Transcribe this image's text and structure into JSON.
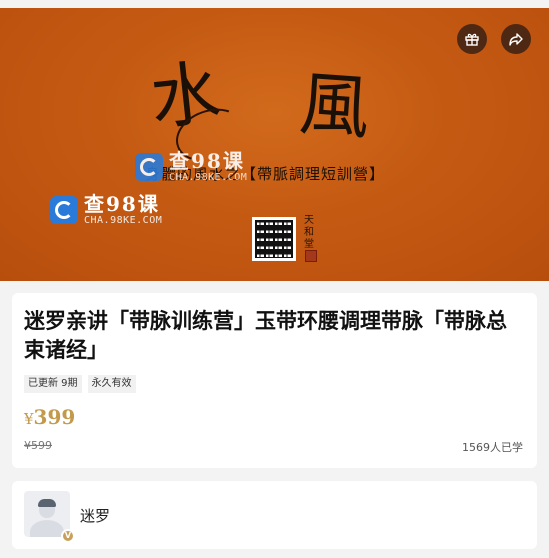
{
  "banner": {
    "calligraphy_left": "水",
    "calligraphy_right": "風",
    "subtitle": "身體的風水之【帶脈調理短訓營】",
    "watermark_main": "查98课",
    "watermark_sub": "CHA.98KE.COM",
    "seal_text": "天和堂",
    "icons": [
      "gift-icon",
      "share-icon"
    ]
  },
  "course": {
    "title": "迷罗亲讲「带脉训练营」玉带环腰调理带脉「带脉总束诸经」",
    "tags": [
      "已更新 9期",
      "永久有效"
    ],
    "price_symbol": "¥",
    "price": "399",
    "original_price": "¥599",
    "learners": "1569人已学",
    "price_color": "#c39a4b"
  },
  "teacher": {
    "name": "迷罗",
    "badge": "V"
  }
}
